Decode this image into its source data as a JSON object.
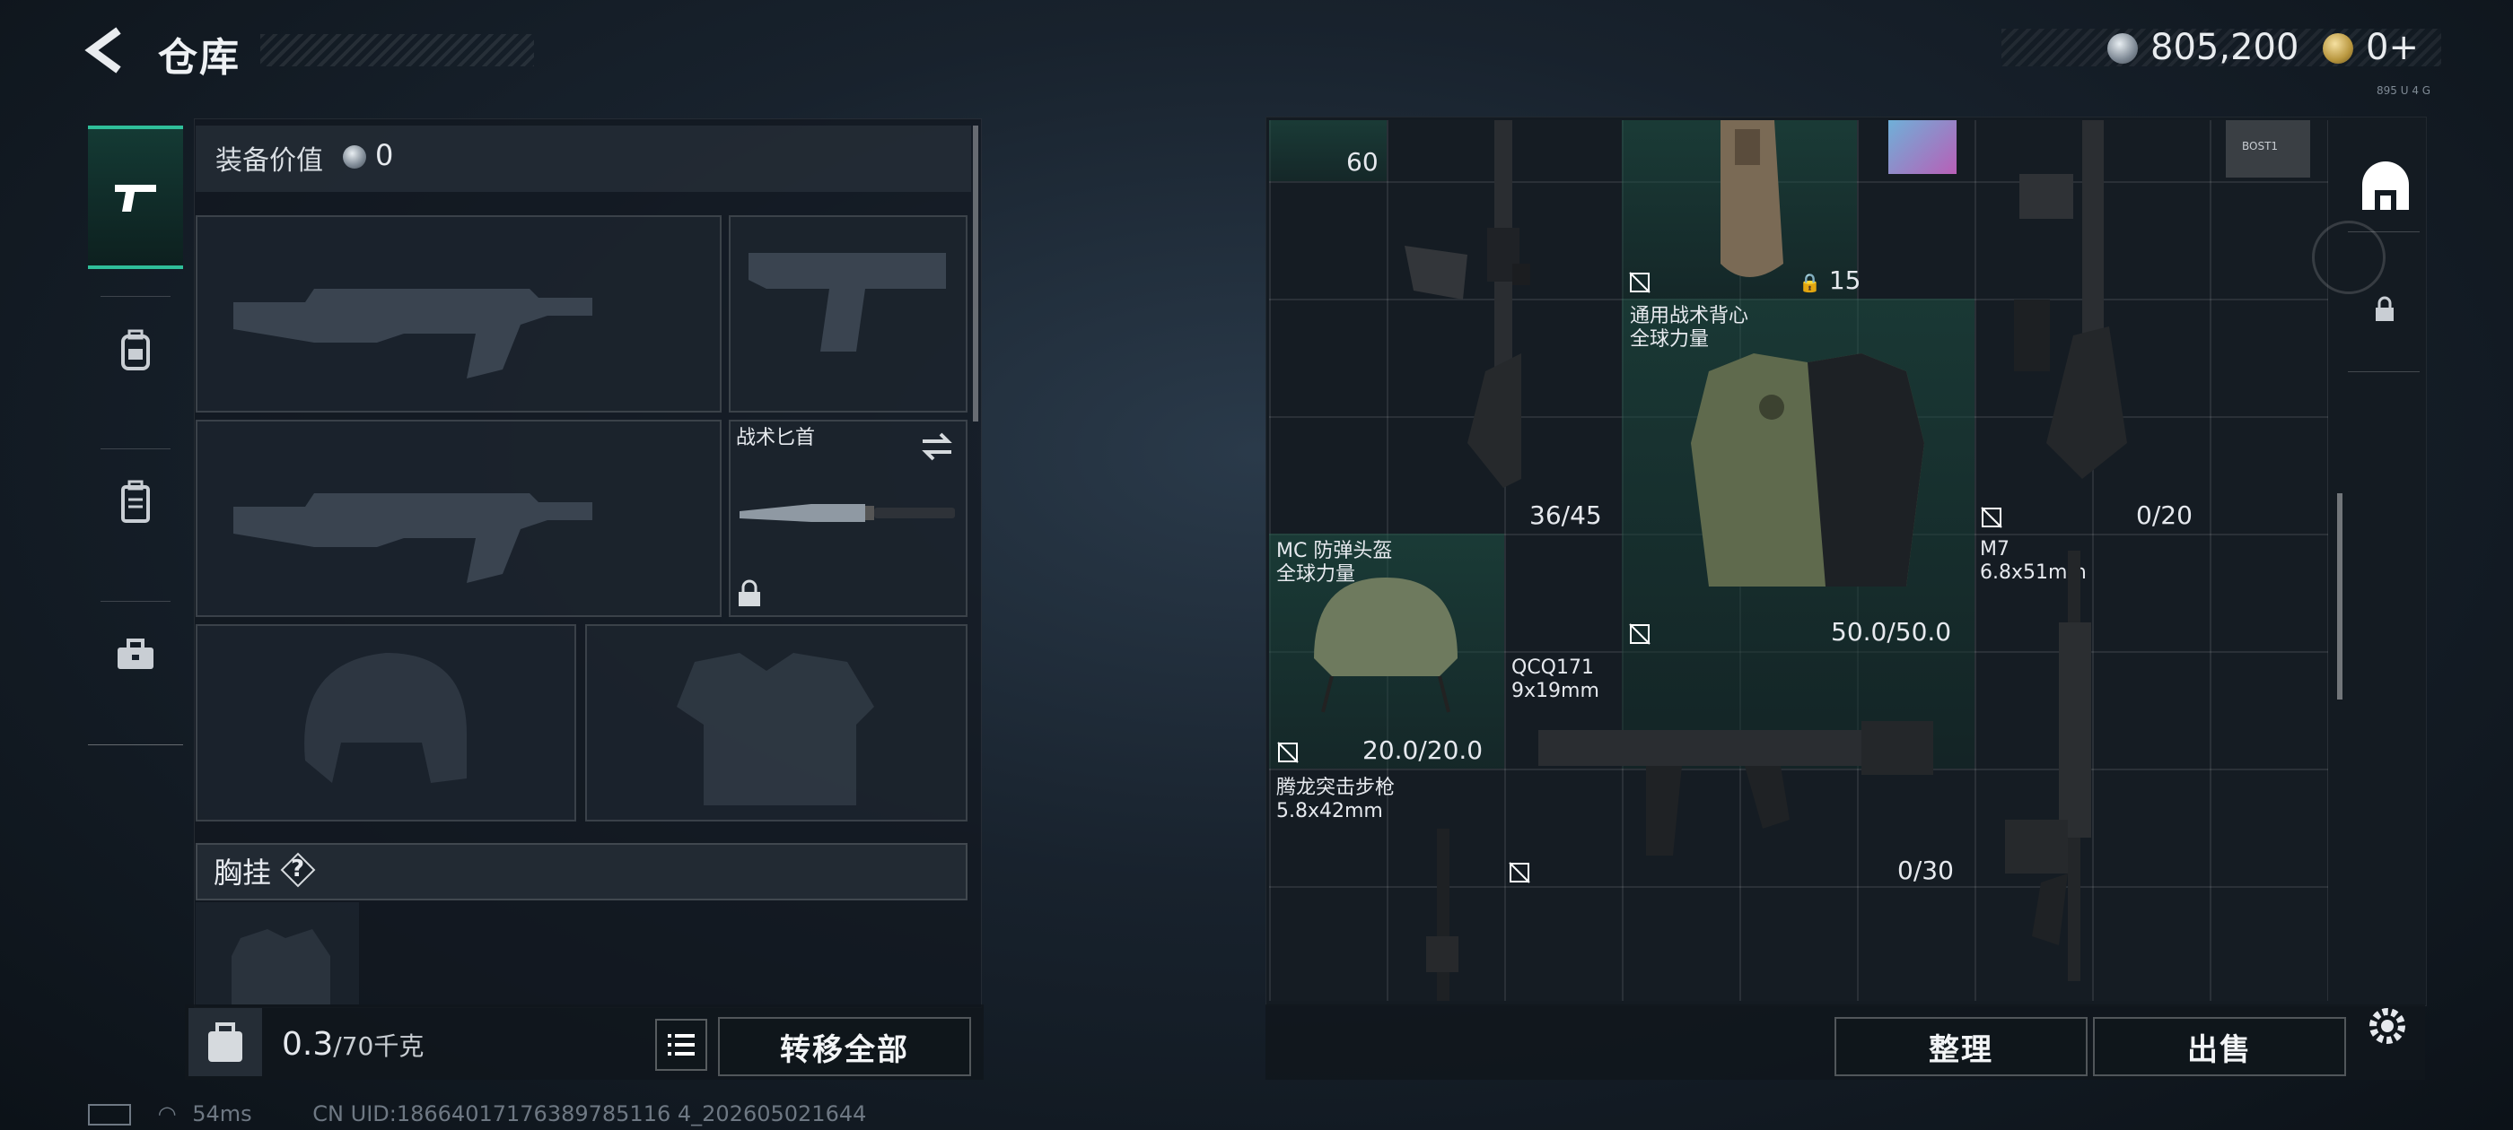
{
  "header": {
    "title": "仓库",
    "money": "805,200",
    "gold": "0+",
    "version": "895 U 4 G"
  },
  "nav": {
    "items": [
      {
        "icon": "pistol-icon",
        "active": true
      },
      {
        "icon": "backpack-icon",
        "active": false
      },
      {
        "icon": "locker-icon",
        "active": false
      },
      {
        "icon": "toolbox-icon",
        "active": false
      }
    ]
  },
  "loadout": {
    "equip_label": "装备价值",
    "equip_value": "0",
    "knife_name": "战术匕首",
    "chest_label": "胸挂",
    "help_mark": "?",
    "weight": "0.3",
    "weight_max": "/70千克",
    "transfer_all": "转移全部"
  },
  "warehouse": {
    "items": {
      "top_value": "60",
      "rifle_ammo": "36/45",
      "backpack_cap": "15",
      "vest_name_line1": "通用战术背心",
      "vest_name_line2": "全球力量",
      "vest_durability": "50.0/50.0",
      "m7_ammo": "0/20",
      "m7_name": "M7",
      "m7_caliber": "6.8x51mm",
      "helmet_line1": "MC 防弹头盔",
      "helmet_line2": "全球力量",
      "helmet_durability": "20.0/20.0",
      "qcq_name": "QCQ171",
      "qcq_caliber": "9x19mm",
      "qcq_ammo": "0/30",
      "tl_name": "腾龙突击步枪",
      "tl_caliber": "5.8x42mm",
      "card_text": "BOST1"
    },
    "sort": "整理",
    "sell": "出售"
  },
  "status": {
    "ping": "54ms",
    "uid": "CN UID:18664017176389785116 4_202605021644"
  },
  "colors": {
    "accent": "#2fbf9a",
    "highlight_cell": "#1e5446"
  }
}
